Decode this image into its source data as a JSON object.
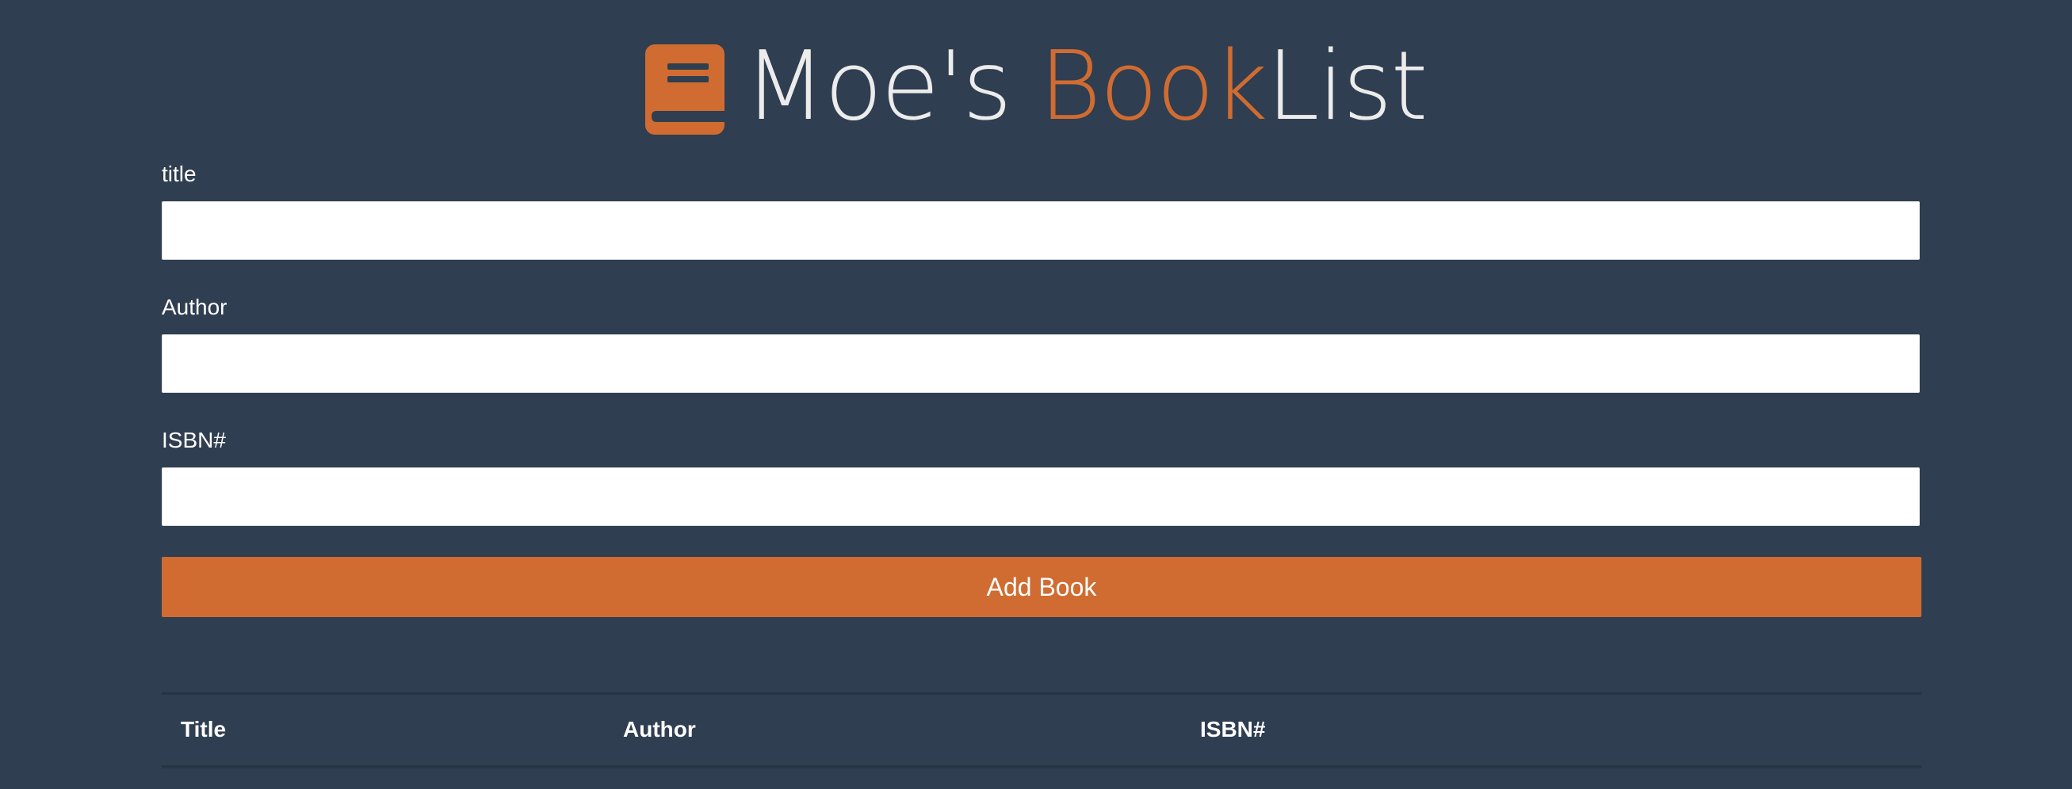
{
  "header": {
    "icon": "book-icon",
    "title_part1": "Moe's ",
    "title_part2": "Book",
    "title_part3": "List"
  },
  "form": {
    "title_label": "title",
    "title_value": "",
    "author_label": "Author",
    "author_value": "",
    "isbn_label": "ISBN#",
    "isbn_value": "",
    "submit_label": "Add Book"
  },
  "table": {
    "columns": [
      "Title",
      "Author",
      "ISBN#"
    ],
    "rows": []
  },
  "colors": {
    "background": "#2f3e50",
    "accent": "#d06c31",
    "text": "#ffffff"
  }
}
